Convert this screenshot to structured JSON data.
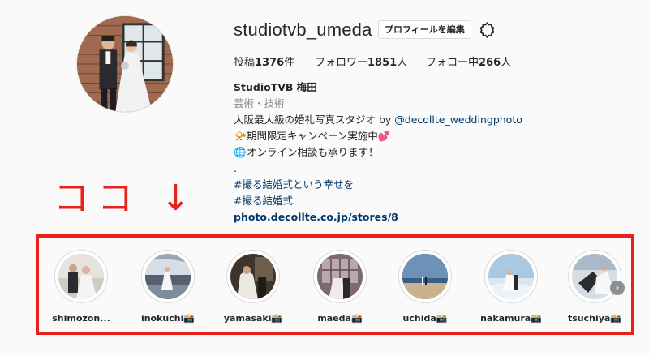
{
  "profile": {
    "username": "studiotvb_umeda",
    "edit_button": "プロフィールを編集",
    "stats": [
      {
        "prefix": "投稿",
        "count": "1376",
        "suffix": "件"
      },
      {
        "prefix": "フォロワー",
        "count": "1851",
        "suffix": "人"
      },
      {
        "prefix": "フォロー中",
        "count": "266",
        "suffix": "人"
      }
    ]
  },
  "bio": {
    "name": "StudioTVB 梅田",
    "category": "芸術・技術",
    "line1_text": "大阪最大級の婚礼写真スタジオ by ",
    "line1_mention": "@decollte_weddingphoto",
    "line2": "期間限定キャンペーン実施中",
    "line3": "オンライン相談も承ります！",
    "line4": ".",
    "tag1": "#撮る結婚式という幸せを",
    "tag2": "#撮る結婚式",
    "url": "photo.decollte.co.jp/stores/8"
  },
  "annotation": {
    "text": "ココ ↓",
    "color": "#e8211a"
  },
  "highlights": [
    {
      "label": "shimozon..."
    },
    {
      "label": "inokuchi📸"
    },
    {
      "label": "yamasaki📸"
    },
    {
      "label": "maeda📸"
    },
    {
      "label": "uchida📸"
    },
    {
      "label": "nakamura📸"
    },
    {
      "label": "tsuchiya📸"
    }
  ],
  "icons": {
    "settings": "gear-icon",
    "next": "chevron-right-icon"
  }
}
